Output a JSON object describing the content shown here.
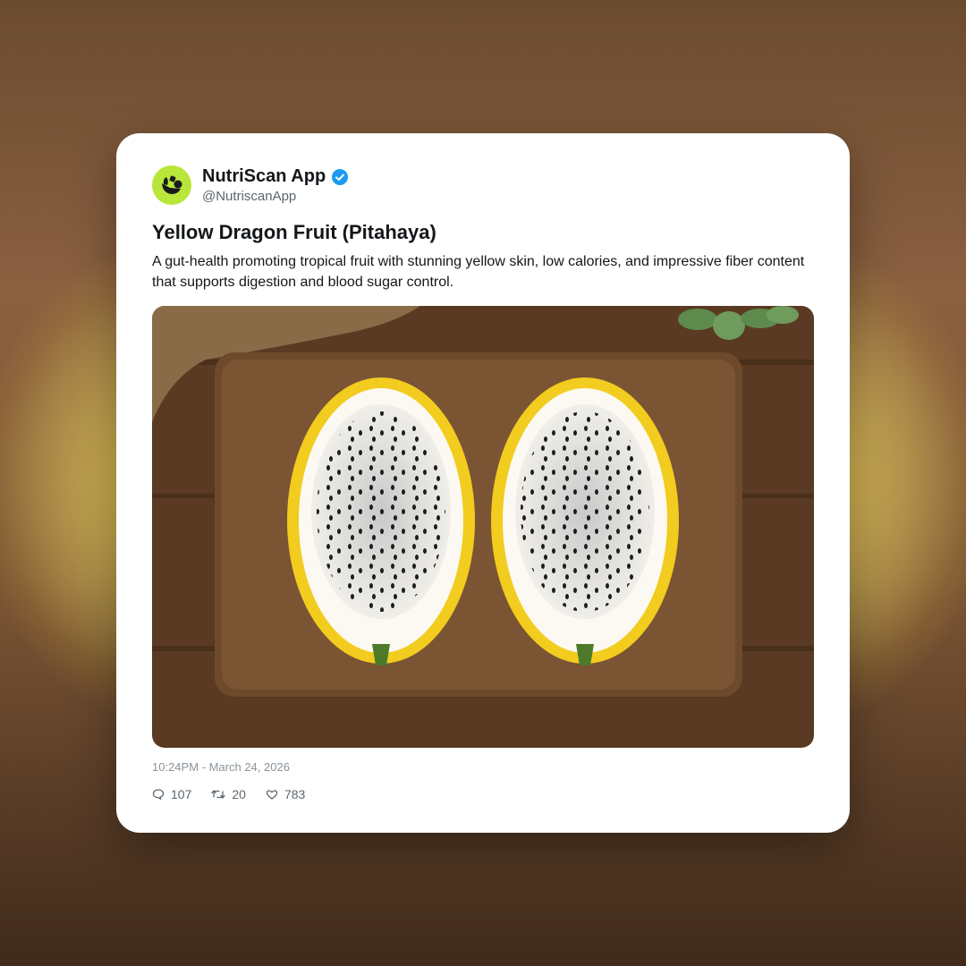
{
  "post": {
    "author": "NutriScan App",
    "handle": "@NutriscanApp",
    "title": "Yellow Dragon Fruit (Pitahaya)",
    "description": "A gut-health promoting tropical fruit with stunning yellow skin, low calories, and impressive fiber content that supports digestion and blood sugar control.",
    "timestamp": "10:24PM - March 24, 2026",
    "verified_color": "#1d9bf0",
    "avatar_color": "#b8e63a",
    "image_subject": "Two halves of a yellow dragon fruit on a wooden cutting board"
  },
  "actions": {
    "replies": "107",
    "reposts": "20",
    "likes": "783",
    "reply_icon": "comment-icon",
    "repost_icon": "repost-icon",
    "like_icon": "heart-icon"
  }
}
